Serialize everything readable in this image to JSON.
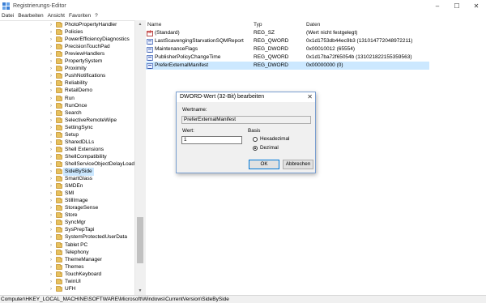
{
  "window": {
    "title": "Registrierungs-Editor",
    "controls": {
      "minimize": "–",
      "maximize": "☐",
      "close": "✕"
    }
  },
  "menu": [
    "Datei",
    "Bearbeiten",
    "Ansicht",
    "Favoriten",
    "?"
  ],
  "tree": {
    "selected_index": 17,
    "items": [
      "PhotoPropertyHandler",
      "Policies",
      "PowerEfficiencyDiagnostics",
      "PrecisionTouchPad",
      "PreviewHandlers",
      "PropertySystem",
      "Proximity",
      "PushNotifications",
      "Reliability",
      "RetailDemo",
      "Run",
      "RunOnce",
      "Search",
      "SelectiveRemoteWipe",
      "SettingSync",
      "Setup",
      "SharedDLLs",
      "Shell Extensions",
      "ShellCompatibility",
      "ShellServiceObjectDelayLoad",
      "SideBySide",
      "SmartGlass",
      "SMDEn",
      "SMI",
      "StillImage",
      "StorageSense",
      "Store",
      "SyncMgr",
      "SysPrepTapi",
      "SystemProtectedUserData",
      "Tablet PC",
      "Telephony",
      "ThemeManager",
      "Themes",
      "TouchKeyboard",
      "TwinUI",
      "UFH"
    ]
  },
  "list": {
    "columns": {
      "name": "Name",
      "type": "Typ",
      "data": "Daten"
    },
    "rows": [
      {
        "name": "(Standard)",
        "type": "REG_SZ",
        "data": "(Wert nicht festgelegt)",
        "icon": "string-value-icon"
      },
      {
        "name": "LastScavengingStarvationSQMReport",
        "type": "REG_QWORD",
        "data": "0x1d1753db44ec9b3 (131014772048972211)",
        "icon": "binary-value-icon"
      },
      {
        "name": "MaintenanceFlags",
        "type": "REG_DWORD",
        "data": "0x00010012 (65554)",
        "icon": "binary-value-icon"
      },
      {
        "name": "PublisherPolicyChangeTime",
        "type": "REG_QWORD",
        "data": "0x1d17ba72f65054b (131021822155359563)",
        "icon": "binary-value-icon"
      },
      {
        "name": "PreferExternalManifest",
        "type": "REG_DWORD",
        "data": "0x00000000 (0)",
        "icon": "binary-value-icon"
      }
    ],
    "selected_row": 4
  },
  "status_bar": "Computer\\HKEY_LOCAL_MACHINE\\SOFTWARE\\Microsoft\\Windows\\CurrentVersion\\SideBySide",
  "dialog": {
    "title": "DWORD-Wert (32-Bit) bearbeiten",
    "close": "✕",
    "value_name_label": "Wertname:",
    "value_name": "PreferExternalManifest",
    "value_label": "Wert:",
    "value": "1",
    "base_label": "Basis",
    "base_options": [
      {
        "label": "Hexadezimal",
        "checked": false
      },
      {
        "label": "Dezimal",
        "checked": true
      }
    ],
    "ok_label": "OK",
    "cancel_label": "Abbrechen"
  }
}
